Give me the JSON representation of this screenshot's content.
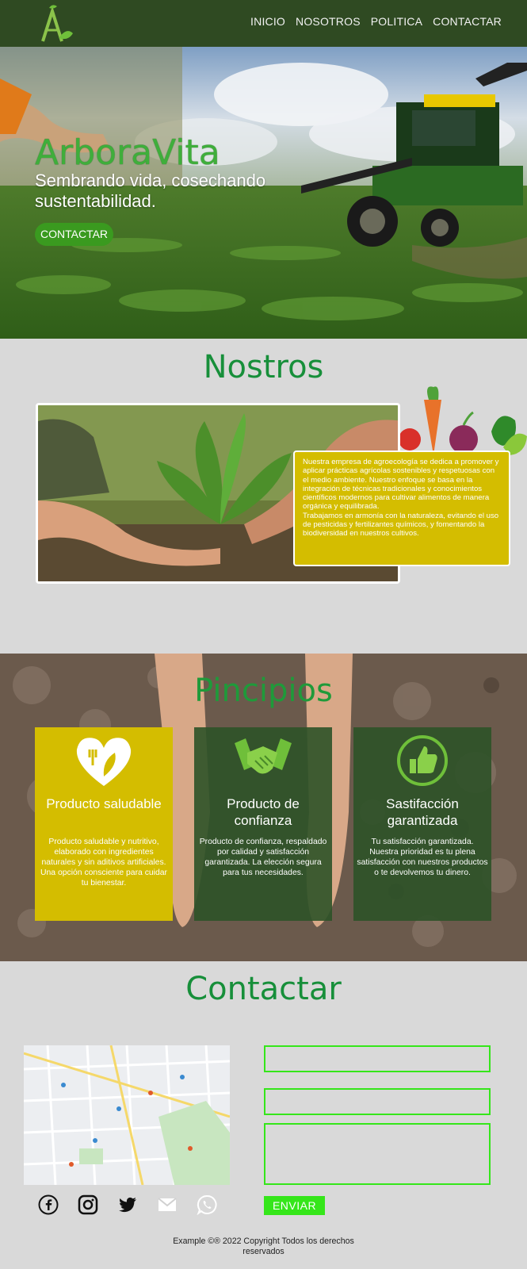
{
  "nav": {
    "links": [
      "INICIO",
      "NOSOTROS",
      "POLITICA",
      "CONTACTAR"
    ]
  },
  "hero": {
    "brand": "ArboraVita",
    "tagline": "Sembrando vida, cosechando sustentabilidad.",
    "button": "CONTACTAR"
  },
  "about": {
    "title": "Nostros",
    "text": "Nuestra empresa de agroecología se dedica a promover y aplicar prácticas agrícolas sostenibles y respetuosas con el medio ambiente. Nuestro enfoque se basa en la integración de técnicas tradicionales y conocimientos científicos modernos para cultivar alimentos de manera orgánica y equilibrada.",
    "text2": "Trabajamos en armonía con la naturaleza, evitando el uso de pesticidas y fertilizantes químicos, y fomentando la biodiversidad en nuestros cultivos."
  },
  "principles": {
    "title": "Pincipios",
    "cards": [
      {
        "title": "Producto saludable",
        "icon": "heart-leaf-icon",
        "text": "Producto saludable y nutritivo, elaborado con ingredientes naturales y sin aditivos artificiales. Una opción consciente para cuidar tu bienestar."
      },
      {
        "title": "Producto de confianza",
        "icon": "handshake-icon",
        "text": "Producto de confianza, respaldado por calidad y satisfacción garantizada. La elección segura para tus necesidades."
      },
      {
        "title": "Sastifacción garantizada",
        "icon": "thumbs-up-icon",
        "text": "Tu satisfacción garantizada. Nuestra prioridad es tu plena satisfacción con nuestros productos o te devolvemos tu dinero."
      }
    ]
  },
  "contact": {
    "title": "Contactar",
    "send": "ENVIAR",
    "socials": [
      "facebook-icon",
      "instagram-icon",
      "twitter-icon",
      "gmail-icon",
      "whatsapp-icon"
    ]
  },
  "footer": {
    "text": "Example ©® 2022 Copyright Todos los derechos reservados"
  },
  "colors": {
    "nav": "#2f4a22",
    "accent_green": "#35e61a",
    "title_green": "#178f3a",
    "yellow": "#d4bd00",
    "card_green": "#2e5228"
  }
}
